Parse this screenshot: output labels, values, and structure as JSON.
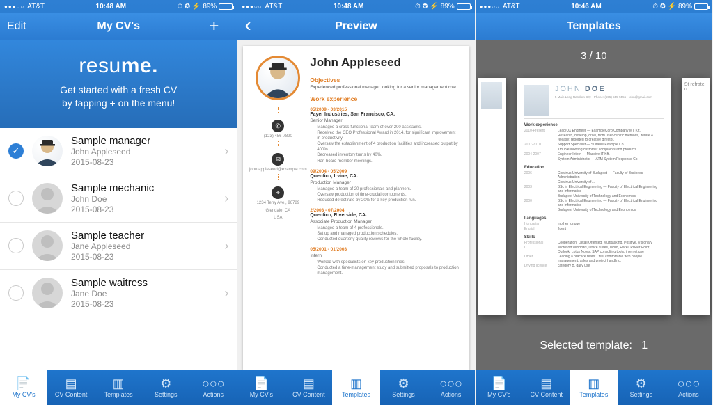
{
  "status": {
    "carrier": "AT&T",
    "time1": "10:48 AM",
    "time2": "10:48 AM",
    "time3": "10:46 AM",
    "battery": "89%",
    "icons": "⏱ ✪ ⚡"
  },
  "screen1": {
    "edit": "Edit",
    "title": "My CV's",
    "logo_a": "resu",
    "logo_b": "me",
    "logo_c": ".",
    "hero_line1": "Get started with a fresh CV",
    "hero_line2": "by tapping + on the menu!",
    "rows": [
      {
        "title": "Sample manager",
        "sub": "John Appleseed",
        "date": "2015-08-23",
        "checked": true,
        "photo": true
      },
      {
        "title": "Sample mechanic",
        "sub": "John Doe",
        "date": "2015-08-23",
        "checked": false,
        "photo": false
      },
      {
        "title": "Sample teacher",
        "sub": "Jane Appleseed",
        "date": "2015-08-23",
        "checked": false,
        "photo": false
      },
      {
        "title": "Sample waitress",
        "sub": "Jane Doe",
        "date": "2015-08-23",
        "checked": false,
        "photo": false
      }
    ]
  },
  "tabs": [
    "My CV's",
    "CV Content",
    "Templates",
    "Settings",
    "Actions"
  ],
  "screen2": {
    "title": "Preview",
    "name": "John Appleseed",
    "objectives_h": "Objectives",
    "objectives": "Experienced professional manager looking for a senior management role.",
    "work_h": "Work experience",
    "phone": "(123) 456-7890",
    "email": "john.appleseed@example.com",
    "addr1": "1234 Terry Ave., 96789",
    "addr2": "Glendale, CA",
    "addr3": "USA",
    "jobs": [
      {
        "dates": "05/2009 - 03/2015",
        "co": "Fayer Industries, San Francisco, CA.",
        "role": "Senior Manager",
        "bullets": [
          "Managed a cross-functional team of over 200 assistants.",
          "Received the CEO Professional Award in 2014, for significant improvement in productivity.",
          "Oversaw the establishment of 4 production facilities and increased output by 400%.",
          "Decreased inventory turns by 40%.",
          "Ran board member meetings."
        ]
      },
      {
        "dates": "09/2004 - 05/2009",
        "co": "Quentico, Irvine, CA.",
        "role": "Production Manager",
        "bullets": [
          "Managed a team of 20 professionals and planners.",
          "Oversaw production of time-crucial components.",
          "Reduced defect rate by 20% for a key production run."
        ]
      },
      {
        "dates": "2/2003 - 07/2004",
        "co": "Quentico, Riverside, CA.",
        "role": "Associate Production Manager",
        "bullets": [
          "Managed a team of 4 professionals.",
          "Set up and managed production schedules.",
          "Conducted quarterly quality reviews for the whole facility."
        ]
      },
      {
        "dates": "05/2001 - 01/2003",
        "co": "",
        "role": "Intern",
        "bullets": [
          "Worked with specialists on key production lines.",
          "Conducted a time-management study and submitted proposals to production management."
        ]
      }
    ]
  },
  "screen3": {
    "title": "Templates",
    "counter": "3 / 10",
    "selected_label": "Selected template:",
    "selected_value": "1",
    "main": {
      "name_a": "JOHN",
      "name_b": "DOE",
      "contact": "5 Main Long Random City · Phone: (555) 555-5555 · john@gmail.com",
      "sections": {
        "work": "Work experience",
        "edu": "Education",
        "lang": "Languages",
        "skills": "Skills"
      },
      "work_items": [
        {
          "l": "2010-Present",
          "r": "Lead/UX Engineer — ExampleCorp Company MT Kft."
        },
        {
          "l": "",
          "r": "Research, develop, drive, from user-centric methods, iterate & release; reported to creative director."
        },
        {
          "l": "2007-2010",
          "r": "Support Specialist — Suitable Example Co."
        },
        {
          "l": "",
          "r": "Troubleshooting customer complaints and products."
        },
        {
          "l": "2004-2007",
          "r": "Engineer Intern — Massive IT Kft."
        },
        {
          "l": "",
          "r": "System Administrator — ATM System Response Co."
        }
      ],
      "edu_items": [
        {
          "l": "2006",
          "r": "Corvinus University of Budapest — Faculty of Business Administration"
        },
        {
          "l": "",
          "r": "Corvinus University of…"
        },
        {
          "l": "2003",
          "r": "BSc in Electrical Engineering — Faculty of Electrical Engineering and Informatics"
        },
        {
          "l": "",
          "r": "Budapest University of Technology and Economics"
        },
        {
          "l": "2000",
          "r": "BSc in Electrical Engineering — Faculty of Electrical Engineering and Informatics"
        },
        {
          "l": "",
          "r": "Budapest University of Technology and Economics"
        }
      ],
      "lang_items": [
        {
          "l": "Hungarian",
          "r": "mother tongue"
        },
        {
          "l": "English",
          "r": "fluent"
        }
      ],
      "skill_items": [
        {
          "l": "Professional",
          "r": "Cooperation, Detail Oriented, Multitasking, Positive, Visionary"
        },
        {
          "l": "IT",
          "r": "Microsoft Windows, Office suites, Word, Excel, Power Point, Outlook, Lotus Notes, SAP consulting tools, internet use"
        },
        {
          "l": "Other",
          "r": "Leading a practice team: I feel comfortable with people management, sales and project handling."
        },
        {
          "l": "Driving licence",
          "r": "category B, daily use"
        }
      ]
    }
  }
}
